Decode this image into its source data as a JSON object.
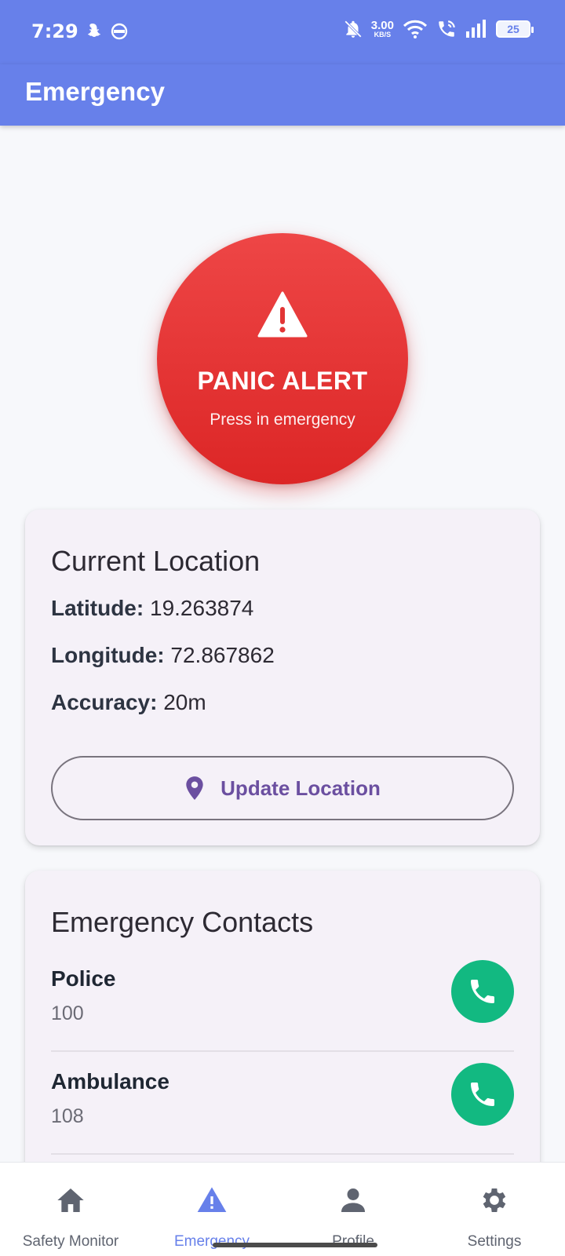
{
  "status_bar": {
    "time": "7:29",
    "net_speed_value": "3.00",
    "net_speed_unit": "KB/S",
    "battery": "25",
    "icons": [
      "snapchat-icon",
      "vpn-icon",
      "bell-off-icon",
      "wifi-icon",
      "wifi-calling-icon",
      "signal-icon",
      "battery-icon"
    ]
  },
  "app_bar": {
    "title": "Emergency"
  },
  "panic": {
    "title": "PANIC ALERT",
    "subtitle": "Press in emergency",
    "icon": "warning-icon",
    "color": "#dc2626"
  },
  "location": {
    "title": "Current Location",
    "latitude_label": "Latitude:",
    "latitude_value": "19.263874",
    "longitude_label": "Longitude:",
    "longitude_value": "72.867862",
    "accuracy_label": "Accuracy:",
    "accuracy_value": "20m",
    "update_button": "Update Location",
    "update_icon": "location-pin-icon"
  },
  "contacts": {
    "title": "Emergency Contacts",
    "items": [
      {
        "name": "Police",
        "number": "100"
      },
      {
        "name": "Ambulance",
        "number": "108"
      }
    ],
    "call_color": "#12b981"
  },
  "bottom_nav": {
    "items": [
      {
        "label": "Safety Monitor",
        "icon": "home-icon"
      },
      {
        "label": "Emergency",
        "icon": "warning-icon"
      },
      {
        "label": "Profile",
        "icon": "person-icon"
      },
      {
        "label": "Settings",
        "icon": "gear-icon"
      }
    ],
    "active": "Emergency",
    "accent": "#6780ea"
  }
}
